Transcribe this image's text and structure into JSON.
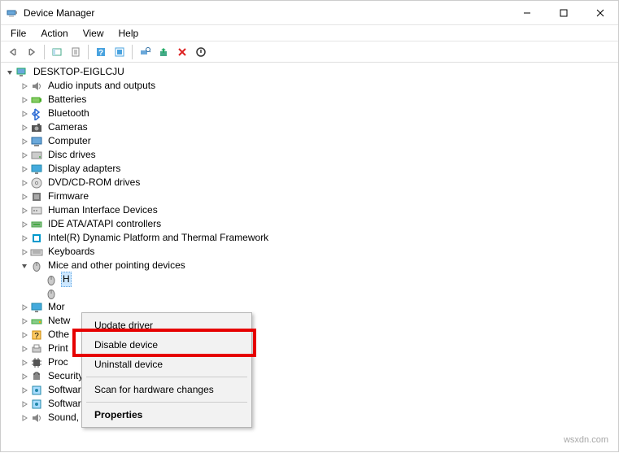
{
  "titlebar": {
    "title": "Device Manager"
  },
  "menubar": {
    "items": [
      "File",
      "Action",
      "View",
      "Help"
    ]
  },
  "tree": {
    "root": "DESKTOP-EIGLCJU",
    "nodes": [
      {
        "label": "Audio inputs and outputs",
        "icon": "speaker"
      },
      {
        "label": "Batteries",
        "icon": "battery"
      },
      {
        "label": "Bluetooth",
        "icon": "bluetooth"
      },
      {
        "label": "Cameras",
        "icon": "camera"
      },
      {
        "label": "Computer",
        "icon": "computer"
      },
      {
        "label": "Disc drives",
        "icon": "disk"
      },
      {
        "label": "Display adapters",
        "icon": "display"
      },
      {
        "label": "DVD/CD-ROM drives",
        "icon": "cd"
      },
      {
        "label": "Firmware",
        "icon": "firmware"
      },
      {
        "label": "Human Interface Devices",
        "icon": "hid"
      },
      {
        "label": "IDE ATA/ATAPI controllers",
        "icon": "ide"
      },
      {
        "label": "Intel(R) Dynamic Platform and Thermal Framework",
        "icon": "intel"
      },
      {
        "label": "Keyboards",
        "icon": "keyboard"
      },
      {
        "label": "Mice and other pointing devices",
        "icon": "mouse",
        "expanded": true,
        "children": [
          {
            "label": "H",
            "icon": "mouse",
            "selected": true
          },
          {
            "label": "",
            "icon": "mouse"
          }
        ]
      },
      {
        "label": "Mor",
        "icon": "monitor"
      },
      {
        "label": "Netw",
        "icon": "network"
      },
      {
        "label": "Othe",
        "icon": "other"
      },
      {
        "label": "Print",
        "icon": "printqueue"
      },
      {
        "label": "Proc",
        "icon": "processor"
      },
      {
        "label": "Security devices",
        "icon": "security"
      },
      {
        "label": "Software components",
        "icon": "software"
      },
      {
        "label": "Software devices",
        "icon": "software"
      },
      {
        "label": "Sound, video and game controllers",
        "icon": "sound"
      }
    ]
  },
  "context_menu": {
    "items": [
      {
        "label": "Update driver"
      },
      {
        "label": "Disable device"
      },
      {
        "label": "Uninstall device"
      },
      {
        "sep": true
      },
      {
        "label": "Scan for hardware changes"
      },
      {
        "sep": true
      },
      {
        "label": "Properties",
        "bold": true
      }
    ]
  },
  "watermark": "wsxdn.com"
}
